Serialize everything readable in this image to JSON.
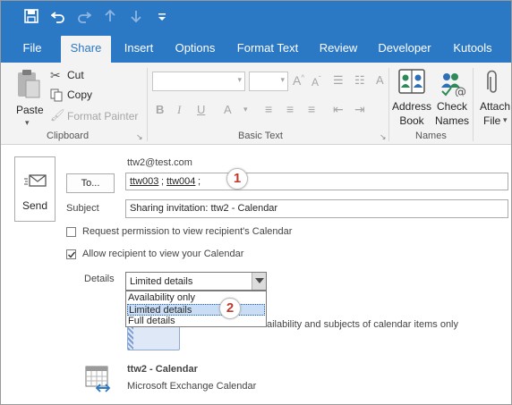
{
  "tabs": [
    "File",
    "Share",
    "Insert",
    "Options",
    "Format Text",
    "Review",
    "Developer",
    "Kutools"
  ],
  "ribbon": {
    "clipboard": {
      "paste": "Paste",
      "cut": "Cut",
      "copy": "Copy",
      "format_painter": "Format Painter",
      "label": "Clipboard"
    },
    "basic_text": {
      "label": "Basic Text"
    },
    "names": {
      "address_book_line1": "Address",
      "address_book_line2": "Book",
      "check_names_line1": "Check",
      "check_names_line2": "Names",
      "label": "Names"
    },
    "attach": {
      "line1": "Attach",
      "line2": "File"
    }
  },
  "message": {
    "send": "Send",
    "from": "ttw2@test.com",
    "to_button": "To...",
    "recipients": [
      "ttw003",
      "ttw004"
    ],
    "subject_label": "Subject",
    "subject_value": "Sharing invitation: ttw2 - Calendar",
    "request_permission": "Request permission to view recipient's Calendar",
    "allow_view": "Allow recipient to view your Calendar",
    "details_label": "Details",
    "details_selected": "Limited details",
    "details_options": [
      "Availability only",
      "Limited details",
      "Full details"
    ],
    "details_note": "ailability and subjects of calendar items only",
    "calendar_name": "ttw2 - Calendar",
    "calendar_type": "Microsoft Exchange Calendar"
  },
  "callouts": [
    "1",
    "2"
  ],
  "colors": {
    "accent": "#2b78c5",
    "callout": "#c0392b"
  }
}
